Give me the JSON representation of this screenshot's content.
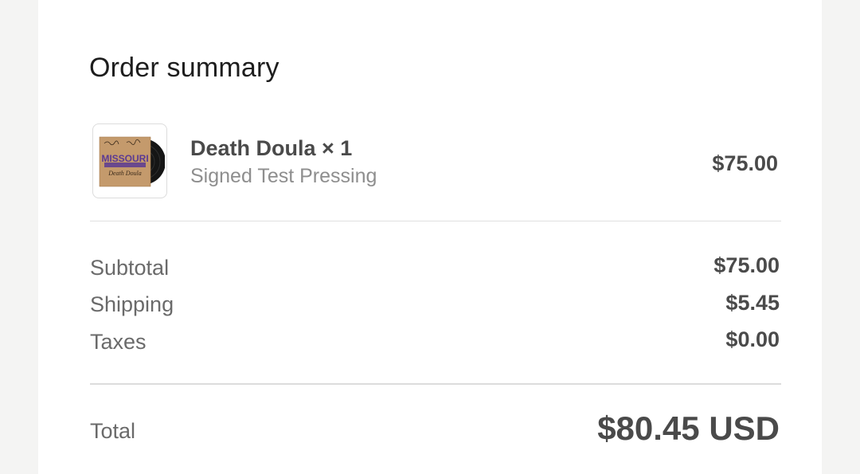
{
  "order_summary": {
    "title": "Order summary",
    "line_item": {
      "name": "Death Doula × 1",
      "variant": "Signed Test Pressing",
      "price": "$75.00",
      "thumbnail": {
        "band_name": "MISSOURI",
        "album_title": "Death Doula"
      }
    },
    "rows": [
      {
        "label": "Subtotal",
        "value": "$75.00"
      },
      {
        "label": "Shipping",
        "value": "$5.45"
      },
      {
        "label": "Taxes",
        "value": "$0.00"
      }
    ],
    "total": {
      "label": "Total",
      "value": "$80.45 USD"
    }
  }
}
